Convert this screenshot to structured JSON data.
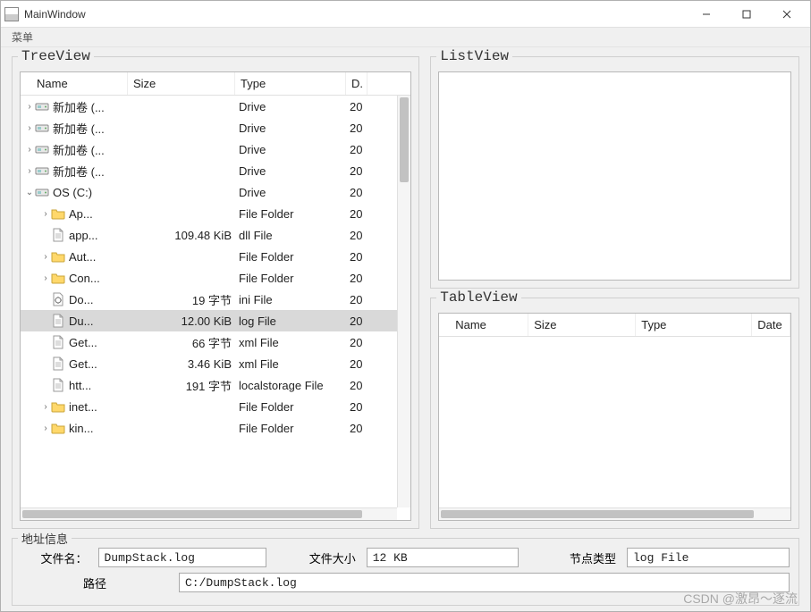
{
  "window": {
    "title": "MainWindow"
  },
  "menubar": {
    "menu1": "菜单"
  },
  "groups": {
    "treeview_title": "TreeView",
    "listview_title": "ListView",
    "tableview_title": "TableView",
    "addr_title": "地址信息"
  },
  "tree": {
    "headers": {
      "name": "Name",
      "size": "Size",
      "type": "Type",
      "date": "D."
    },
    "rows": [
      {
        "depth": 0,
        "expand": "closed",
        "icon": "drive",
        "name": "新加卷 (...",
        "size": "",
        "type": "Drive",
        "date": "20"
      },
      {
        "depth": 0,
        "expand": "closed",
        "icon": "drive",
        "name": "新加卷 (...",
        "size": "",
        "type": "Drive",
        "date": "20"
      },
      {
        "depth": 0,
        "expand": "closed",
        "icon": "drive",
        "name": "新加卷 (...",
        "size": "",
        "type": "Drive",
        "date": "20"
      },
      {
        "depth": 0,
        "expand": "closed",
        "icon": "drive",
        "name": "新加卷 (...",
        "size": "",
        "type": "Drive",
        "date": "20"
      },
      {
        "depth": 0,
        "expand": "open",
        "icon": "drive",
        "name": "OS (C:)",
        "size": "",
        "type": "Drive",
        "date": "20"
      },
      {
        "depth": 1,
        "expand": "closed",
        "icon": "folder",
        "name": "Ap...",
        "size": "",
        "type": "File Folder",
        "date": "20"
      },
      {
        "depth": 1,
        "expand": "none",
        "icon": "file",
        "name": "app...",
        "size": "109.48 KiB",
        "type": "dll File",
        "date": "20"
      },
      {
        "depth": 1,
        "expand": "closed",
        "icon": "folder",
        "name": "Aut...",
        "size": "",
        "type": "File Folder",
        "date": "20"
      },
      {
        "depth": 1,
        "expand": "closed",
        "icon": "folder",
        "name": "Con...",
        "size": "",
        "type": "File Folder",
        "date": "20"
      },
      {
        "depth": 1,
        "expand": "none",
        "icon": "ini",
        "name": "Do...",
        "size": "19 字节",
        "type": "ini File",
        "date": "20"
      },
      {
        "depth": 1,
        "expand": "none",
        "icon": "file",
        "name": "Du...",
        "size": "12.00 KiB",
        "type": "log File",
        "date": "20",
        "selected": true
      },
      {
        "depth": 1,
        "expand": "none",
        "icon": "file",
        "name": "Get...",
        "size": "66 字节",
        "type": "xml File",
        "date": "20"
      },
      {
        "depth": 1,
        "expand": "none",
        "icon": "file",
        "name": "Get...",
        "size": "3.46 KiB",
        "type": "xml File",
        "date": "20"
      },
      {
        "depth": 1,
        "expand": "none",
        "icon": "file",
        "name": "htt...",
        "size": "191 字节",
        "type": "localstorage File",
        "date": "20"
      },
      {
        "depth": 1,
        "expand": "closed",
        "icon": "folder",
        "name": "inet...",
        "size": "",
        "type": "File Folder",
        "date": "20"
      },
      {
        "depth": 1,
        "expand": "closed",
        "icon": "folder",
        "name": "kin...",
        "size": "",
        "type": "File Folder",
        "date": "20"
      }
    ]
  },
  "table": {
    "headers": {
      "name": "Name",
      "size": "Size",
      "type": "Type",
      "date": "Date"
    }
  },
  "addr": {
    "filename_label": "文件名：",
    "filename_value": "DumpStack.log",
    "filesize_label": "文件大小",
    "filesize_value": "12 KB",
    "nodetype_label": "节点类型",
    "nodetype_value": "log File",
    "path_label": "路径",
    "path_value": "C:/DumpStack.log"
  },
  "watermark": "CSDN @激昂～逐流"
}
